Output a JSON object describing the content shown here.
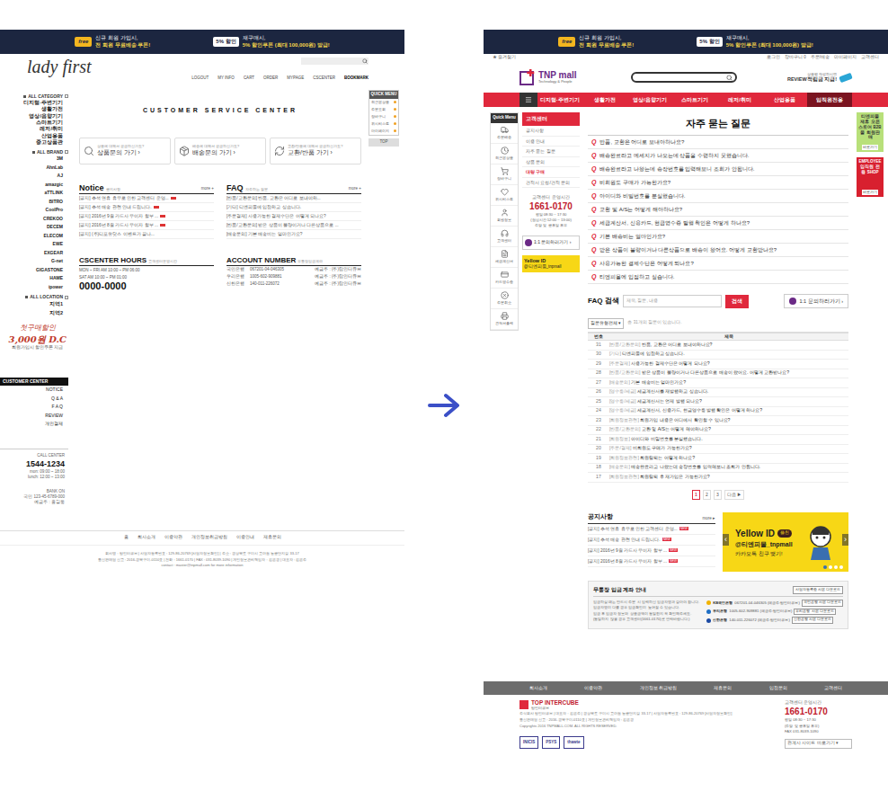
{
  "left_page": {
    "banner": {
      "left_badge": "free",
      "left_text": [
        "신규 회원 가입시,",
        "전 회원 무료배송 쿠폰!"
      ],
      "right_badge": "5% 할인",
      "right_text": [
        "재구매시,",
        "5% 할인쿠폰 (최대 100,000원) 발급!"
      ]
    },
    "logo": "lady first",
    "nav": [
      {
        "label": "LOGOUT",
        "selected": false
      },
      {
        "label": "MY INFO",
        "selected": false
      },
      {
        "label": "CART",
        "selected": false
      },
      {
        "label": "ORDER",
        "selected": false
      },
      {
        "label": "MYPAGE",
        "selected": false
      },
      {
        "label": "CSCENTER",
        "selected": false
      },
      {
        "label": "BOOKMARK",
        "selected": true
      }
    ],
    "quick_menu": {
      "title": "QUICK MENU",
      "items": [
        "최근본상품",
        "주문조회",
        "장바구니",
        "위시리스트",
        "마이페이지"
      ],
      "top": "TOP"
    },
    "sidebar": {
      "category_title": "ALL CATEGORY",
      "categories": [
        "디지털·주변기기",
        "생활가전",
        "영상/음향기기",
        "스마트기기",
        "레저/취미",
        "산업용품",
        "중고상품관"
      ],
      "brand_title": "ALL BRAND",
      "brands": [
        "3M",
        "AhnLab",
        "AJ",
        "amazgic",
        "aTTLINK",
        "BITRO",
        "CoolPro",
        "CREKOO",
        "DECEM",
        "ELECOM",
        "EWE",
        "EXGEAR",
        "G-net",
        "GIGASTONE",
        "HAME",
        "ipower"
      ],
      "location_title": "ALL LOCATION",
      "locations": [
        "지역1",
        "지역2"
      ],
      "promo": {
        "line1": "첫구매할인",
        "line2": "3,000원 D.C",
        "line3": "회원가입시 할인쿠폰 지급"
      },
      "cs_title": "CUSTOMER CENTER",
      "cs_items": [
        "NOTICE",
        "Q & A",
        "F A Q",
        "REVIEW",
        "개인결제"
      ],
      "call_label": "CALL CENTER",
      "call_number": "1544-1234",
      "call_hours": [
        "mon: 09:00 ~ 18:00",
        "lunch: 12:00 ~ 13:00"
      ],
      "bank_label": "BANK ON",
      "bank_lines": [
        "국민 123-45-6789-000",
        "예금주 : 홍길동"
      ]
    },
    "title": "CUSTOMER SERVICE CENTER",
    "shortcuts": [
      {
        "caption": "상품에 대해서 궁금하신가요?",
        "label": "상품문의 가기 ›"
      },
      {
        "caption": "배송에 대해서 궁금하신가요?",
        "label": "배송문의 가기 ›"
      },
      {
        "caption": "교환/반품에 대해서 궁금하신가요?",
        "label": "교환/반품 가기 ›"
      }
    ],
    "notice": {
      "title": "Notice",
      "subtitle": "공지사항",
      "more": "more +",
      "items": [
        {
          "text": "[공지] 추석 연휴 휴무로 인한 고객센터 운영...",
          "new": true
        },
        {
          "text": "[공지] 추석 배송 관련 안내 드립니다.",
          "new": true
        },
        {
          "text": "[공지] 2016년 9월 카드사 무이자 할부 ...",
          "new": true
        },
        {
          "text": "[공지] 2016년 8월 카드사 무이자 할부 ...",
          "new": true
        },
        {
          "text": "[공지] (주)티포유닷스 이벤트가 끝나...",
          "new": false
        }
      ]
    },
    "faq": {
      "title": "FAQ",
      "subtitle": "자주하는 질문",
      "more": "more +",
      "items": [
        "[반품/교환문의] 반품, 교환은 어디로 보내야하...",
        "[기타] 티엔피몰에 입점하고 싶습니다.",
        "[주문결제] 사용가능한 결제수단은 어떻게 되나요?",
        "[반품/교환문의] 받은 상품이 불량이거나 다른상품으로 ...",
        "[배송문의] 기본 배송비는 얼마인가요?"
      ]
    },
    "hours": {
      "title": "CSCENTER HOURS",
      "subtitle": "고객센터운영시간",
      "lines": [
        "MON ~ FRI AM 10:00 ~ PM 06:00",
        "SAT AM 10:00 ~ PM 01:00"
      ],
      "phone": "0000-0000"
    },
    "account": {
      "title": "ACCOUNT NUMBER",
      "subtitle": "무통장입금계좌",
      "rows": [
        {
          "bank": "국민은행",
          "number": "067201-04-046305",
          "holder": "예금주 : (주)탑인터큐브"
        },
        {
          "bank": "우리은행",
          "number": "1005-602-909881",
          "holder": "예금주 : (주)탑인터큐브"
        },
        {
          "bank": "신한은행",
          "number": "140-011-226072",
          "holder": "예금주 : (주)탑인터큐브"
        }
      ]
    },
    "footer": {
      "links": [
        "홈",
        "회사소개",
        "이용약관",
        "개인정보취급방침",
        "이용안내",
        "제휴문의"
      ],
      "lines": [
        "회사명 : 탑인터큐브 | 사업자등록번호 : 129-86-20769 [사업자정보확인] | 주소 : 경상북도 구미시 고아읍 농공단지길 33-17",
        "통신판매업 신고 : 2016-경북구미-0110호 | 전화 : 1661-0170 | FAX : 031-8039-1090 | 개인정보관리책임자 : 김은경 | 대표자 : 김은주",
        "contact : master@tnpmall.com for more information"
      ]
    }
  },
  "right_page": {
    "banner": {
      "left_badge": "free",
      "left_text": [
        "신규 회원 가입시,",
        "전 회원 무료배송 쿠폰!"
      ],
      "right_badge": "5% 할인",
      "right_text": [
        "재구매시,",
        "5% 할인쿠폰 (최대 100,000원) 발급!"
      ]
    },
    "util": {
      "bookmark": "즐겨찾기",
      "links": [
        "로그인",
        "장바구니 0",
        "주문/배송",
        "마이페이지",
        "고객센터"
      ]
    },
    "logo": {
      "name": "TNP mall",
      "tagline": "Technology & People"
    },
    "review_ad": {
      "line1": "상품평 작성하시면",
      "line2": "REVIEW적립금 지급!"
    },
    "nav": [
      {
        "label": "디지털·주변기기",
        "selected": false
      },
      {
        "label": "생활가전",
        "selected": false
      },
      {
        "label": "영상/음향기기",
        "selected": false
      },
      {
        "label": "스마트기기",
        "selected": false
      },
      {
        "label": "레저/취미",
        "selected": false
      },
      {
        "label": "산업용품",
        "selected": false
      },
      {
        "label": "임직원전용",
        "selected": true
      }
    ],
    "quick_menu": {
      "title": "Quick Menu",
      "items": [
        "주문배송",
        "최근본상품",
        "장바구니",
        "위시리스트",
        "회원정보",
        "고객센터",
        "세금계산서",
        "카드영수증",
        "주문취소",
        "견적서출력"
      ]
    },
    "cs_sidebar": {
      "title": "고객센터",
      "items": [
        {
          "label": "공지사항",
          "selected": false
        },
        {
          "label": "이용 안내",
          "selected": false
        },
        {
          "label": "자주 묻는 질문",
          "selected": false
        },
        {
          "label": "상품 문의",
          "selected": false
        },
        {
          "label": "대량 구매",
          "selected": true
        },
        {
          "label": "견적서 요청/견적 문의",
          "selected": false
        }
      ],
      "phone_label": "고객센터 운영시간",
      "phone": "1661-0170",
      "hours": [
        "평일 08:30 ~ 17:30",
        "(점심시간 12:00 ~ 13:00)",
        "주말 및 공휴일 휴무"
      ],
      "inquiry": "1:1 문의하러가기 ›",
      "yellow_title": "Yellow ID",
      "yellow_handle": "@티엔피몰_tnpmall"
    },
    "faq_title": "자주 묻는 질문",
    "faq_top": [
      "반품, 교환은 어디로 보내야하나요?",
      "배송완료라고 메세지가 나오는데 상품을 수령하지 못했습니다.",
      "배송완료라고 나왔는데 송장번호를 입력해보니 조회가 안됩니다.",
      "비회원도 구매가 가능한가요?",
      "아이디와 비밀번호를 분실했습니다.",
      "교환 및 A/S는 어떻게 해야하나요?",
      "세금계산서, 신용카드, 현금영수증 발행 확인은 어떻게 하나요?",
      "기본 배송비는 얼마인가요?",
      "받은 상품이 불량이거나 다른상품으로 배송이 왔어요. 어떻게 교환받나요?",
      "사용가능한 결제수단은 어떻게 되나요?",
      "티엔피몰에 입점하고 싶습니다."
    ],
    "faq_q": "Q",
    "search": {
      "label": "FAQ 검색",
      "placeholder": "제목, 질문, 내용",
      "button": "검색",
      "inquiry": "1:1 문의하러가기 ›"
    },
    "filter": {
      "value": "질문유형전체 ▾",
      "note": "총 31개의 질문이 있습니다."
    },
    "table": {
      "columns": [
        "번호",
        "제목"
      ],
      "rows": [
        {
          "no": "31",
          "category": "[반품/교환문의]",
          "title": "반품, 교환은 어디로 보내야하나요?"
        },
        {
          "no": "30",
          "category": "[기타]",
          "title": "티엔피몰에 입점하고 싶습니다."
        },
        {
          "no": "29",
          "category": "[주문결제]",
          "title": "사용가능한 결제수단은 어떻게 되나요?"
        },
        {
          "no": "28",
          "category": "[반품/교환문의]",
          "title": "받은 상품이 불량이거나 다른상품으로 배송이 왔어요. 어떻게 교환받나요?"
        },
        {
          "no": "27",
          "category": "[배송문의]",
          "title": "기본 배송비는 얼마인가요?"
        },
        {
          "no": "26",
          "category": "[영수증/세금]",
          "title": "세금계산서를 재발행하고 싶습니다."
        },
        {
          "no": "25",
          "category": "[영수증/세금]",
          "title": "세금계산서는 언제 발행 되나요?"
        },
        {
          "no": "24",
          "category": "[영수증/세금]",
          "title": "세금계산서, 신용카드, 현금영수증 발행 확인은 어떻게 하나요?"
        },
        {
          "no": "23",
          "category": "[회원정보관련]",
          "title": "회원가입 내용은 어디에서 확인할 수 있나요?"
        },
        {
          "no": "22",
          "category": "[반품/교환문의]",
          "title": "교환 및 A/S는 어떻게 해야하나요?"
        },
        {
          "no": "21",
          "category": "[회원정보]",
          "title": "아이디와 비밀번호를 분실했습니다."
        },
        {
          "no": "20",
          "category": "[주문/결제]",
          "title": "비회원도 구매가 가능한가요?"
        },
        {
          "no": "19",
          "category": "[회원정보관련]",
          "title": "회원탈퇴는 어떻게 하나요?"
        },
        {
          "no": "18",
          "category": "[배송문의]",
          "title": "배송완료라고 나왔는데 송장번호를 입력해보니 조회가 안됩니다."
        },
        {
          "no": "17",
          "category": "[회원정보관련]",
          "title": "회원탈퇴 후 재가입은 가능한가요?"
        }
      ]
    },
    "pagination": [
      {
        "label": "1",
        "selected": true
      },
      {
        "label": "2",
        "selected": false
      },
      {
        "label": "3",
        "selected": false
      },
      {
        "label": "다음 ▶",
        "selected": false
      }
    ],
    "notice": {
      "title": "공지사항",
      "more": "more ▸",
      "items": [
        {
          "text": "[공지] 추석 연휴 휴무로 인한 고객센터 운영...",
          "new": true
        },
        {
          "text": "[공지] 추석 배송 관련 안내 드립니다.",
          "new": true
        },
        {
          "text": "[공지] 2016년 9월 카드사 무이자 할부 ...",
          "new": true
        },
        {
          "text": "[공지] 2016년 8월 카드사 무이자 할부 ...",
          "new": true
        }
      ],
      "new_label": "NEW"
    },
    "kakao": {
      "title": "Yellow ID",
      "badge": "플친",
      "handle": "@티엔피몰_tnpmall",
      "cta": "카카오톡 친구 맺기!",
      "prev": "‹",
      "next": "›",
      "dots": [
        {
          "selected": true
        },
        {
          "selected": false
        },
        {
          "selected": false
        },
        {
          "selected": false
        }
      ]
    },
    "deposit": {
      "title": "무통장 입금 계좌 안내",
      "button": "사업자등록증 사본 다운로드",
      "lines": [
        "입금하실 때는 반드시 주문 시 입력하신 입금자명과 같아야 합니다.",
        "입금자명이 다를 경우 입금확인이 늦어질 수 있습니다.",
        "입금 후 입금자 정보와 상품금액이 동일한지 꼭 확인해주세요.",
        "(동일하지 않을 경우 고객센터(1661-0170)로 연락바랍니다.)"
      ],
      "accounts": [
        {
          "bank": "KB국민은행",
          "number": "067201-04-046305 (예금주:탑인터큐브)",
          "button": "국민은행 사본 다운로드",
          "color": "#f2b300"
        },
        {
          "bank": "우리은행",
          "number": "1005-602-909881 (예금주:탑인터큐브)",
          "button": "우리은행 사본 다운로드",
          "color": "#1f6fc5"
        },
        {
          "bank": "신한은행",
          "number": "140-011-226072 (예금주:탑인터큐브)",
          "button": "신한은행 사본 다운로드",
          "color": "#1c4aa3"
        }
      ]
    },
    "side_banners": [
      {
        "title": "티엔피몰 제휴 오픈스토어 B2B몰 회원판매",
        "label": "바로가기",
        "color": "#b8e07a"
      },
      {
        "title": "EMPLOYEE 임직원 전용 SHOP",
        "label": "바로가기",
        "color": "#d8202f"
      }
    ],
    "footer": {
      "links": [
        "회사소개",
        "이용약관",
        "개인정보 취급방침",
        "제휴문의",
        "입점문의",
        "고객센터"
      ],
      "company": "TOP INTERCUBE",
      "company_sub": "탑인터큐브",
      "lines": [
        "주식회사 탑인터큐브 | 대표자 : 김은주 | 경상북도 구미시 고아읍 농공단지길 33-17 | 사업자등록번호 : 129-86-20769 [사업자정보확인]",
        "통신판매업 신고 : 2016-경북구미-0110호 | 개인정보관리책임자 : 김은경",
        "Copyrights 2016 TNPMALL.COM. ALL RIGHTS RESERVED."
      ],
      "certs": [
        "INICIS",
        "PSYS",
        "thawte"
      ],
      "cs_label": "고객센터 운영시간",
      "cs_number": "1661-0170",
      "cs_lines": [
        "평일 08:30 ~ 17:30",
        "(주말 및 공휴일 휴무)",
        "FAX 031-8039-1090"
      ],
      "family": "관계사 사이트 바로가기 ▾"
    }
  }
}
